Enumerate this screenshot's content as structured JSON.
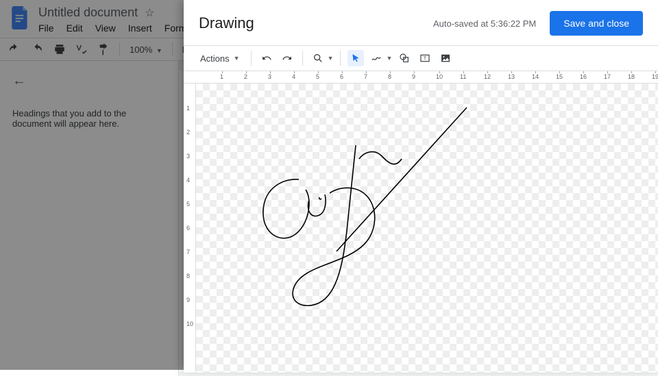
{
  "docs": {
    "title": "Untitled document",
    "menu": {
      "file": "File",
      "edit": "Edit",
      "view": "View",
      "insert": "Insert",
      "format": "Forma"
    },
    "zoom": "100%",
    "style": "Norm",
    "outline_hint": "Headings that you add to the document will appear here."
  },
  "drawing": {
    "title": "Drawing",
    "autosave": "Auto-saved at 5:36:22 PM",
    "save_close": "Save and close",
    "actions": "Actions",
    "ruler_h": [
      "1",
      "2",
      "3",
      "4",
      "5",
      "6",
      "7",
      "8",
      "9",
      "10",
      "11",
      "12",
      "13",
      "14",
      "15",
      "16",
      "17",
      "18",
      "19"
    ],
    "ruler_v": [
      "1",
      "2",
      "3",
      "4",
      "5",
      "6",
      "7",
      "8",
      "9",
      "10"
    ],
    "icons": {
      "undo": "undo-icon",
      "redo": "redo-icon",
      "zoom": "zoom-icon",
      "select": "select-icon",
      "scribble": "scribble-icon",
      "shape": "shape-icon",
      "textbox": "textbox-icon",
      "image": "image-icon"
    }
  }
}
